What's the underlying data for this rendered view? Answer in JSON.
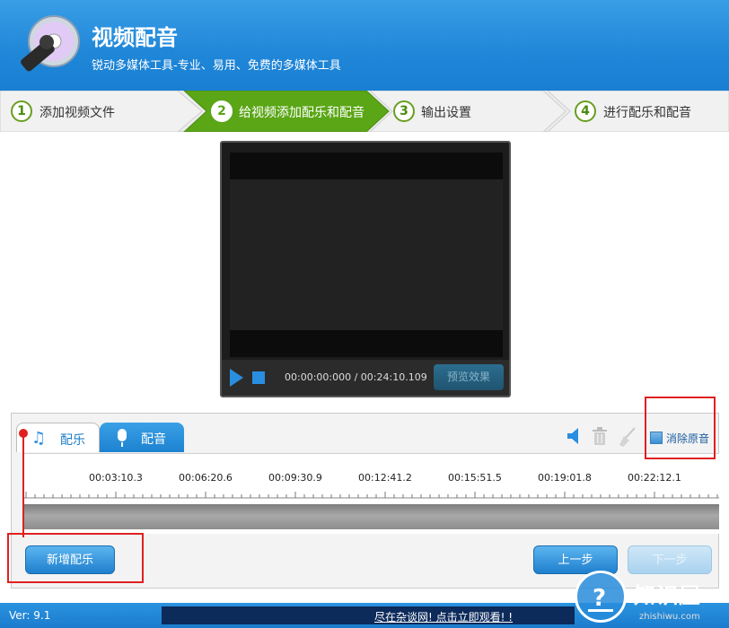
{
  "app": {
    "title": "视频配音",
    "subtitle": "锐动多媒体工具-专业、易用、免费的多媒体工具"
  },
  "steps": [
    {
      "num": "1",
      "label": "添加视频文件",
      "active": false
    },
    {
      "num": "2",
      "label": "给视频添加配乐和配音",
      "active": true
    },
    {
      "num": "3",
      "label": "输出设置",
      "active": false
    },
    {
      "num": "4",
      "label": "进行配乐和配音",
      "active": false
    }
  ],
  "player": {
    "time": "00:00:00:000 / 00:24:10.109",
    "preview_label": "预览效果"
  },
  "tabs": {
    "music": "配乐",
    "dub": "配音"
  },
  "toolbar": {
    "mute_label": "消除原音"
  },
  "timeline": {
    "ticks": [
      "00:03:10.3",
      "00:06:20.6",
      "00:09:30.9",
      "00:12:41.2",
      "00:15:51.5",
      "00:19:01.8",
      "00:22:12.1"
    ]
  },
  "buttons": {
    "add_music": "新增配乐",
    "prev": "上一步",
    "next": "下一步"
  },
  "status": {
    "version": "Ver: 9.1",
    "ad": "尽在杂谈网! 点击立即观看! !"
  },
  "watermark": {
    "brand": "知识屋",
    "url": "zhishiwu.com"
  },
  "colors": {
    "header_blue": "#2590de",
    "active_step_green": "#5aa616",
    "annotation_red": "#e02020"
  }
}
